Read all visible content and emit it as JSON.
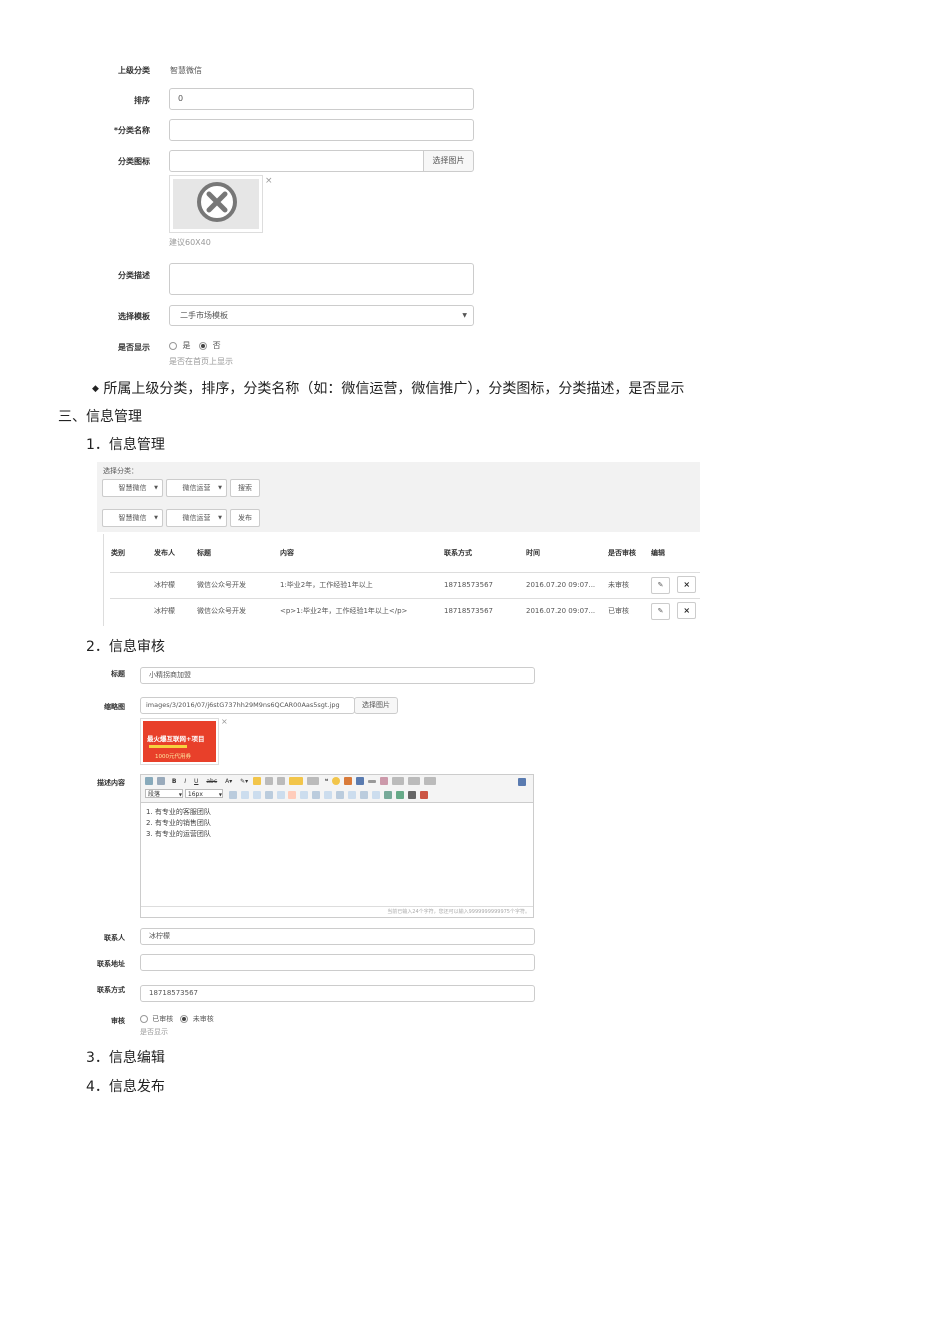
{
  "form1": {
    "parent_label": "上级分类",
    "parent_value": "智慧微信",
    "sort_label": "排序",
    "sort_value": "0",
    "name_label": "*分类名称",
    "icon_label": "分类图标",
    "icon_button": "选择图片",
    "icon_hint": "建议60X40",
    "desc_label": "分类描述",
    "template_label": "选择模板",
    "template_value": "二手市场模板",
    "show_label": "是否显示",
    "show_yes": "是",
    "show_no": "否",
    "show_hint": "是否在首页上显示"
  },
  "doc": {
    "bullet_text": "所属上级分类，排序，分类名称（如：微信运营，微信推广），分类图标，分类描述，是否显示",
    "section3": "三、信息管理",
    "item1": "1．信息管理",
    "item2": "2．信息审核",
    "item3": "3．信息编辑",
    "item4": "4．信息发布"
  },
  "info_mgmt": {
    "select_label": "选择分类：",
    "sel1": "智慧微信",
    "sel2": "微信运营",
    "search_btn": "搜索",
    "sel3": "智慧微信",
    "sel4": "微信运营",
    "publish_btn": "发布",
    "headers": [
      "类别",
      "发布人",
      "标题",
      "内容",
      "联系方式",
      "时间",
      "是否审核",
      "编辑"
    ],
    "rows": [
      {
        "cat": "",
        "publisher": "冰柠檬",
        "title": "微信公众号开发",
        "content": "1:毕业2年，工作经验1年以上",
        "contact": "18718573567",
        "time": "2016.07.20 09:07...",
        "status": "未审核"
      },
      {
        "cat": "",
        "publisher": "冰柠檬",
        "title": "微信公众号开发",
        "content": "<p>1:毕业2年，工作经验1年以上</p>",
        "contact": "18718573567",
        "time": "2016.07.20 09:07...",
        "status": "已审核"
      }
    ]
  },
  "review": {
    "title_label": "标题",
    "title_value": "小精拐商加盟",
    "thumb_label": "缩略图",
    "thumb_value": "images/3/2016/07/j6stG737hh29M9ns6QCAR00Aas5sgt.jpg",
    "thumb_button": "选择图片",
    "ad_line1": "最火爆互联网+项目",
    "ad_line2": "1000元代用券",
    "desc_label": "描述内容",
    "editor_para": "段落",
    "editor_size": "16px",
    "editor_lines": [
      "1.  有专业的客服团队",
      "2.  有专业的销售团队",
      "3.  有专业的运营团队"
    ],
    "editor_status": "当前已输入24个字符，您还可以输入9999999999975个字符。",
    "contact_label": "联系人",
    "contact_value": "冰柠檬",
    "addr_label": "联系地址",
    "phone_label": "联系方式",
    "phone_value": "18718573567",
    "audit_label": "审核",
    "audit_yes": "已审核",
    "audit_no": "未审核",
    "audit_hint": "是否显示"
  }
}
